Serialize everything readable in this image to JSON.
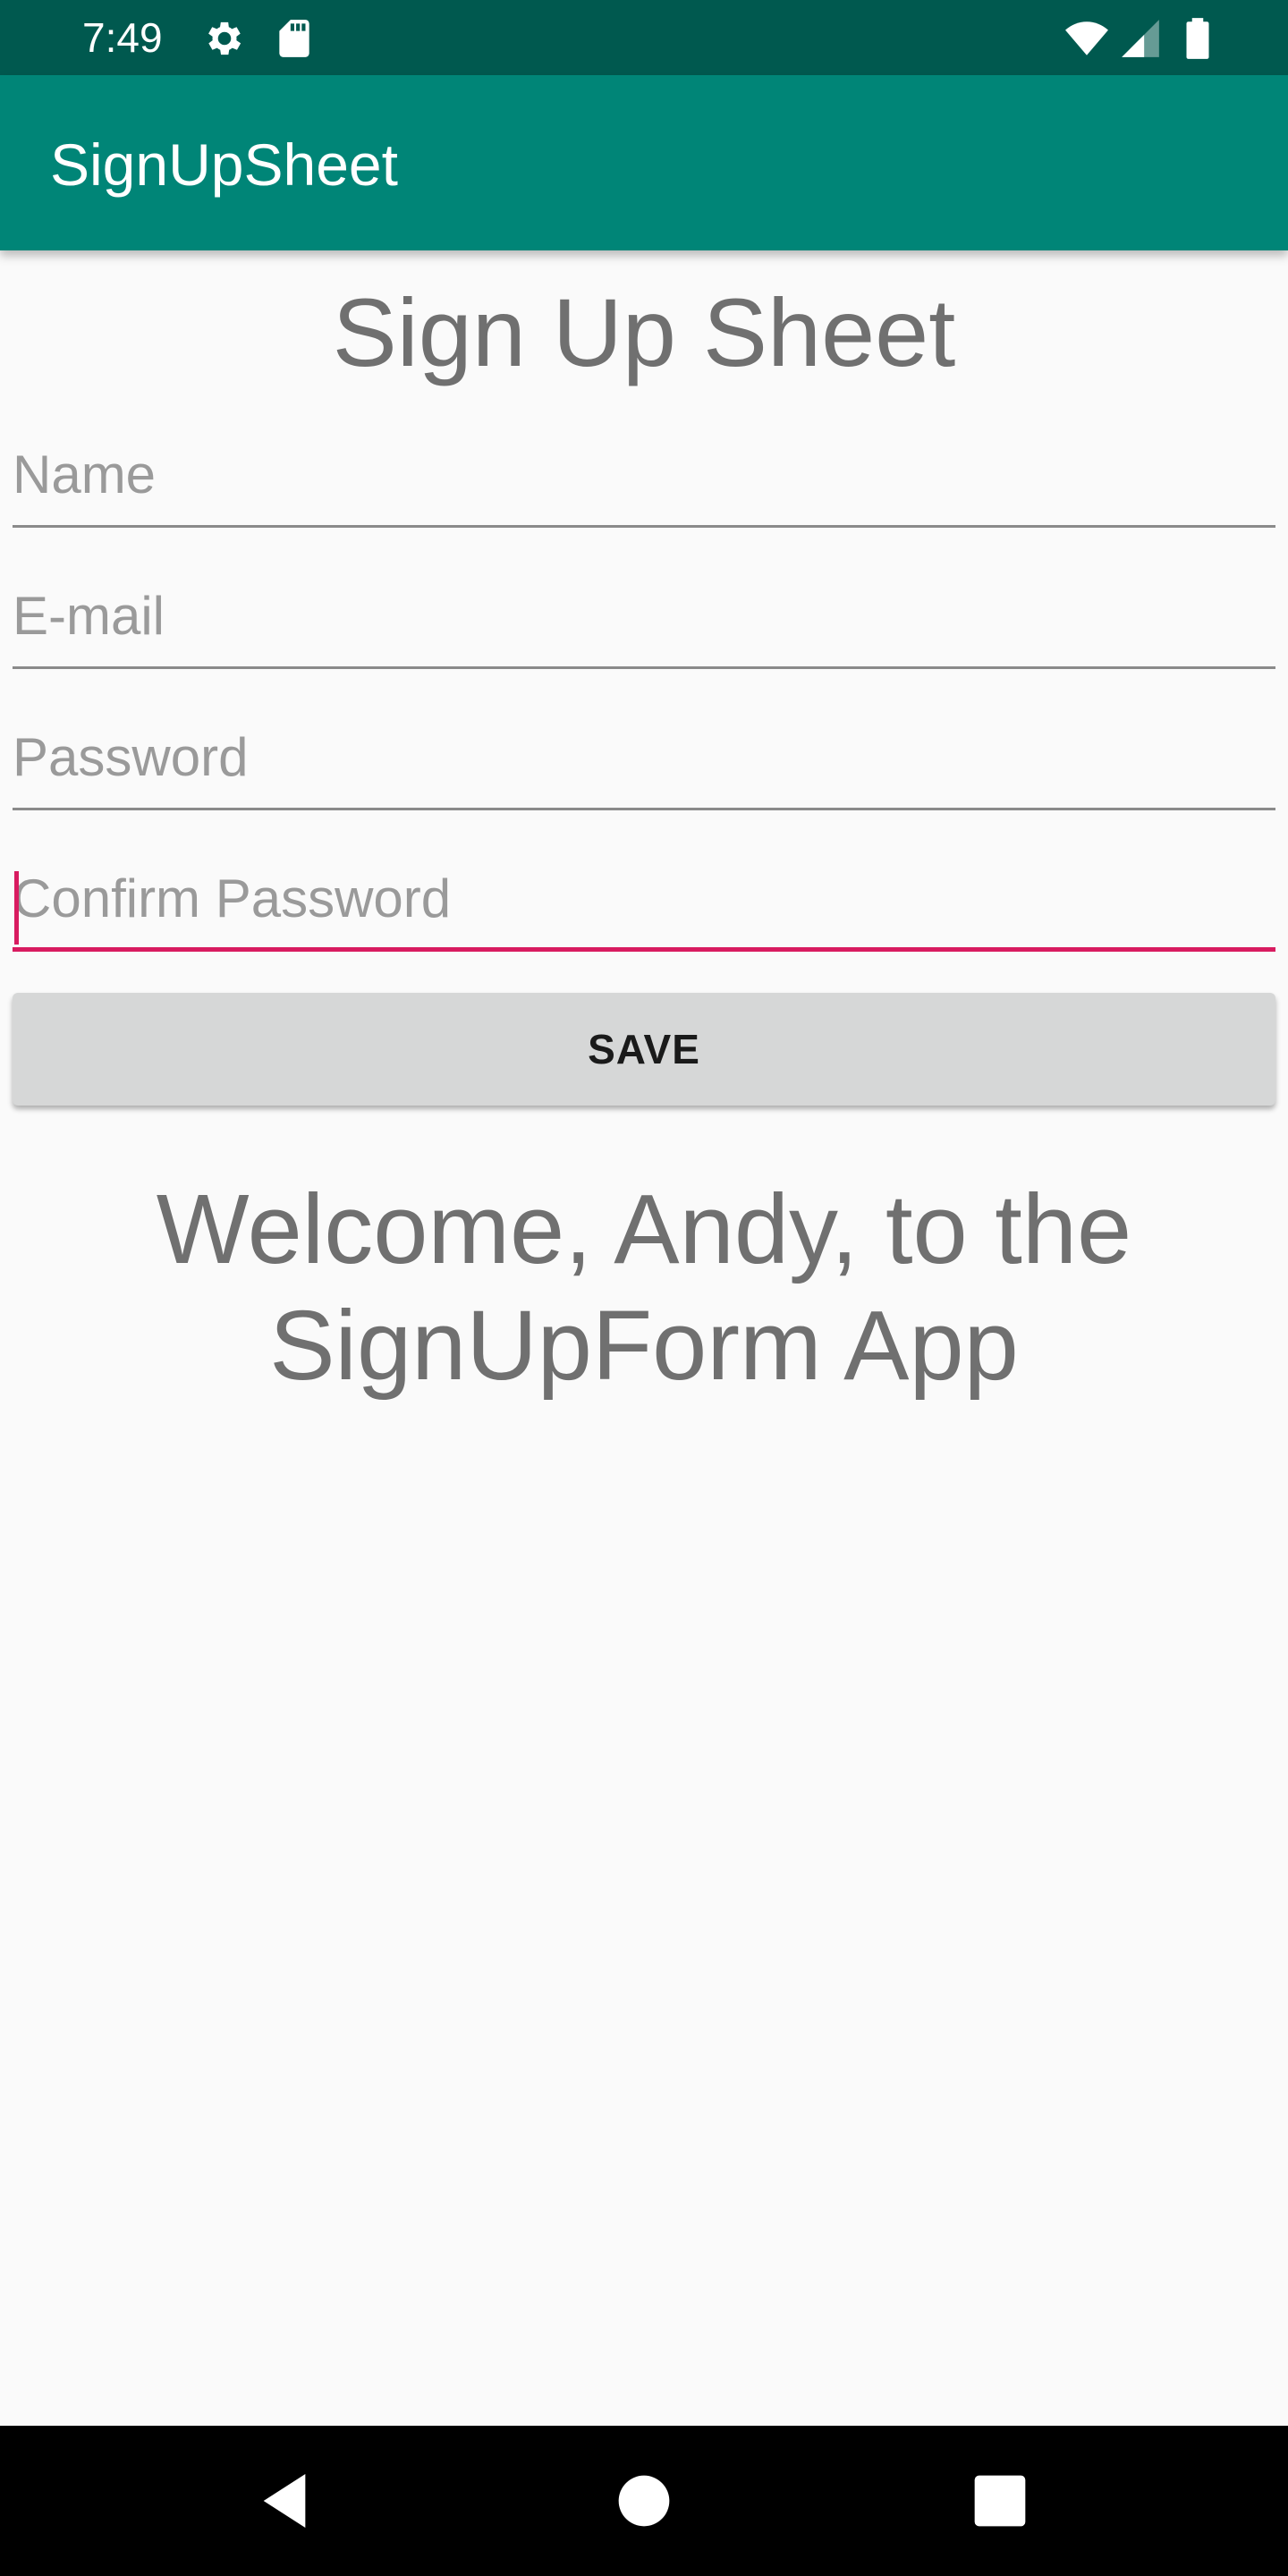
{
  "status_bar": {
    "time": "7:49",
    "icons": [
      "settings-icon",
      "sd-card-icon",
      "wifi-icon",
      "signal-icon",
      "battery-icon"
    ],
    "background": "#00594f"
  },
  "app_bar": {
    "title": "SignUpSheet",
    "background": "#008577"
  },
  "form": {
    "heading": "Sign Up Sheet",
    "fields": [
      {
        "placeholder": "Name",
        "value": ""
      },
      {
        "placeholder": "E-mail",
        "value": ""
      },
      {
        "placeholder": "Password",
        "value": ""
      },
      {
        "placeholder": "Confirm Password",
        "value": "",
        "focused": true
      }
    ],
    "save_label": "SAVE",
    "accent": "#d81b60"
  },
  "welcome": {
    "line1": "Welcome, Andy, to the",
    "line2": "SignUpForm App"
  },
  "nav_bar": {
    "buttons": [
      "back-icon",
      "home-icon",
      "recents-icon"
    ]
  }
}
